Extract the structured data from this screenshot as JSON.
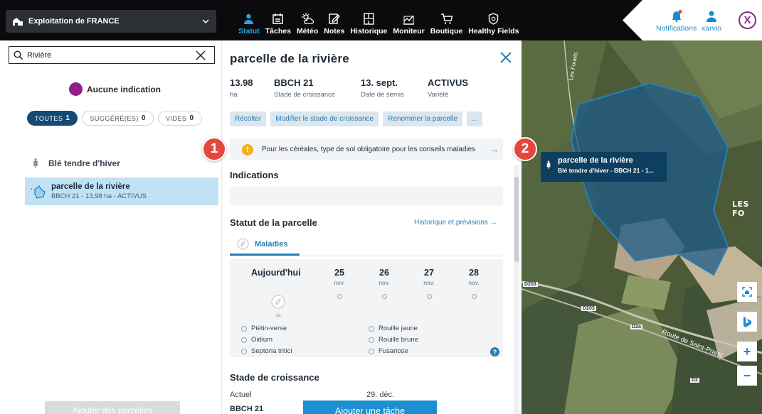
{
  "farm": {
    "name": "Exploitation de FRANCE"
  },
  "nav": [
    {
      "label": "Statut",
      "icon": "status-icon",
      "active": true
    },
    {
      "label": "Tâches",
      "icon": "tasks-icon"
    },
    {
      "label": "Météo",
      "icon": "weather-icon"
    },
    {
      "label": "Notes",
      "icon": "notes-icon"
    },
    {
      "label": "Historique",
      "icon": "history-icon"
    },
    {
      "label": "Moniteur",
      "icon": "monitor-icon"
    },
    {
      "label": "Boutique",
      "icon": "cart-icon"
    },
    {
      "label": "Healthy Fields",
      "icon": "shield-icon"
    }
  ],
  "header_right": {
    "notifications": "Notifications",
    "user": "xarvio",
    "logo_letter": "X",
    "accent": "#8a2a86"
  },
  "search": {
    "value": "Rivière"
  },
  "indication": {
    "label": "Aucune indication",
    "color": "#8e1f8d"
  },
  "filters": [
    {
      "label": "TOUTES",
      "count": "1"
    },
    {
      "label": "SUGGÉRÉ(ES)",
      "count": "0"
    },
    {
      "label": "VIDES",
      "count": "0"
    }
  ],
  "crop_group": {
    "label": "Blé tendre d'hiver"
  },
  "parcel_item": {
    "name": "parcelle de la rivière",
    "info": "BBCH 21 - 13,98 ha - ACTIVUS"
  },
  "left_footer": {
    "add_parcels": "Ajouter des parcelles"
  },
  "detail": {
    "title": "parcelle de la rivière",
    "stats": [
      {
        "value": "13.98",
        "label": "ha"
      },
      {
        "value": "BBCH 21",
        "label": "Stade de croissance"
      },
      {
        "value": "13. sept.",
        "label": "Date de semis"
      },
      {
        "value": "ACTIVUS",
        "label": "Variété"
      }
    ],
    "actions": [
      "Récolter",
      "Modifier le stade de croissance",
      "Renommer la parcelle",
      "..."
    ],
    "warning": "Pour les céréales, type de sol obligatoire pour les conseils maladies",
    "warning_arrow": "→",
    "indications_title": "Indications",
    "status_title": "Statut de la parcelle",
    "history_link": "Historique et prévisions →",
    "tab": "Maladies",
    "forecast": {
      "today": "Aujourd'hui",
      "days": [
        {
          "num": "25",
          "month": "nov."
        },
        {
          "num": "26",
          "month": "nov."
        },
        {
          "num": "27",
          "month": "nov."
        },
        {
          "num": "28",
          "month": "nov."
        }
      ],
      "diseases_left": [
        "Piétin-verse",
        "Oidium",
        "Septoria tritici"
      ],
      "diseases_right": [
        "Rouille jaune",
        "Rouille brune",
        "Fusariose"
      ],
      "help": "?"
    },
    "growth": {
      "title": "Stade de croissance",
      "current_label": "Actuel",
      "current_value": "BBCH 21",
      "date": "29. déc."
    },
    "add_task": "Ajouter une tâche"
  },
  "map": {
    "parcel_name": "parcelle de la rivière",
    "parcel_info": "Blé tendre d'hiver - BBCH 21 - 1...",
    "place": "LES FO",
    "road_small": "Les Fouets",
    "road": "Route de Saint-Priest",
    "road_labels": [
      "D203",
      "D203",
      "D2a",
      "D2"
    ],
    "buttons": [
      "home",
      "b",
      "+",
      "−"
    ]
  },
  "badges": [
    "1",
    "2"
  ]
}
